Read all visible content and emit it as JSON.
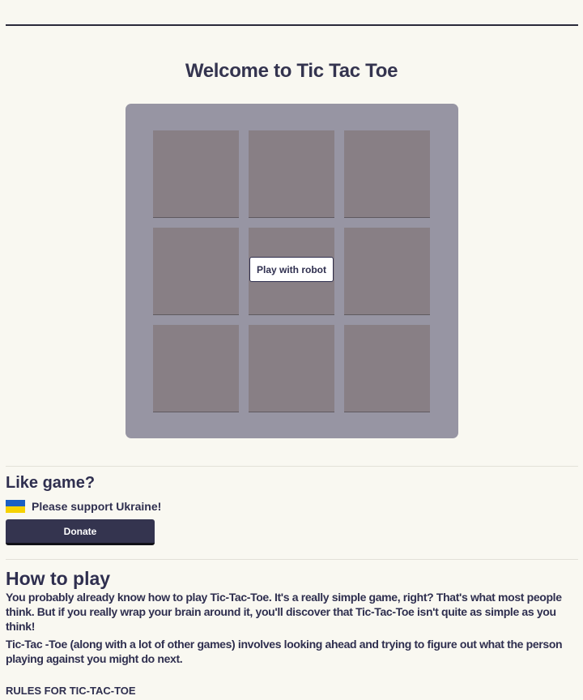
{
  "page": {
    "title": "Welcome to Tic Tac Toe"
  },
  "board": {
    "cells": [
      "",
      "",
      "",
      "",
      "",
      "",
      "",
      "",
      ""
    ],
    "robot_button_label": "Play with robot",
    "colors": {
      "board_bg": "#9795a3",
      "cell_bg": "#887f85"
    }
  },
  "like": {
    "heading": "Like game?",
    "flag_icon": "ukraine-flag-icon",
    "support_text": "Please support Ukraine!",
    "donate_label": "Donate"
  },
  "howto": {
    "heading": "How to play",
    "paragraph1": "You probably already know how to play Tic-Tac-Toe. It's a really simple game, right? That's what most people think. But if you really wrap your brain around it, you'll discover that Tic-Tac-Toe isn't quite as simple as you think!",
    "paragraph2": "Tic-Tac -Toe (along with a lot of other games) involves looking ahead and trying to figure out what the person playing against you might do next.",
    "rules_heading": "RULES FOR TIC-TAC-TOE"
  }
}
